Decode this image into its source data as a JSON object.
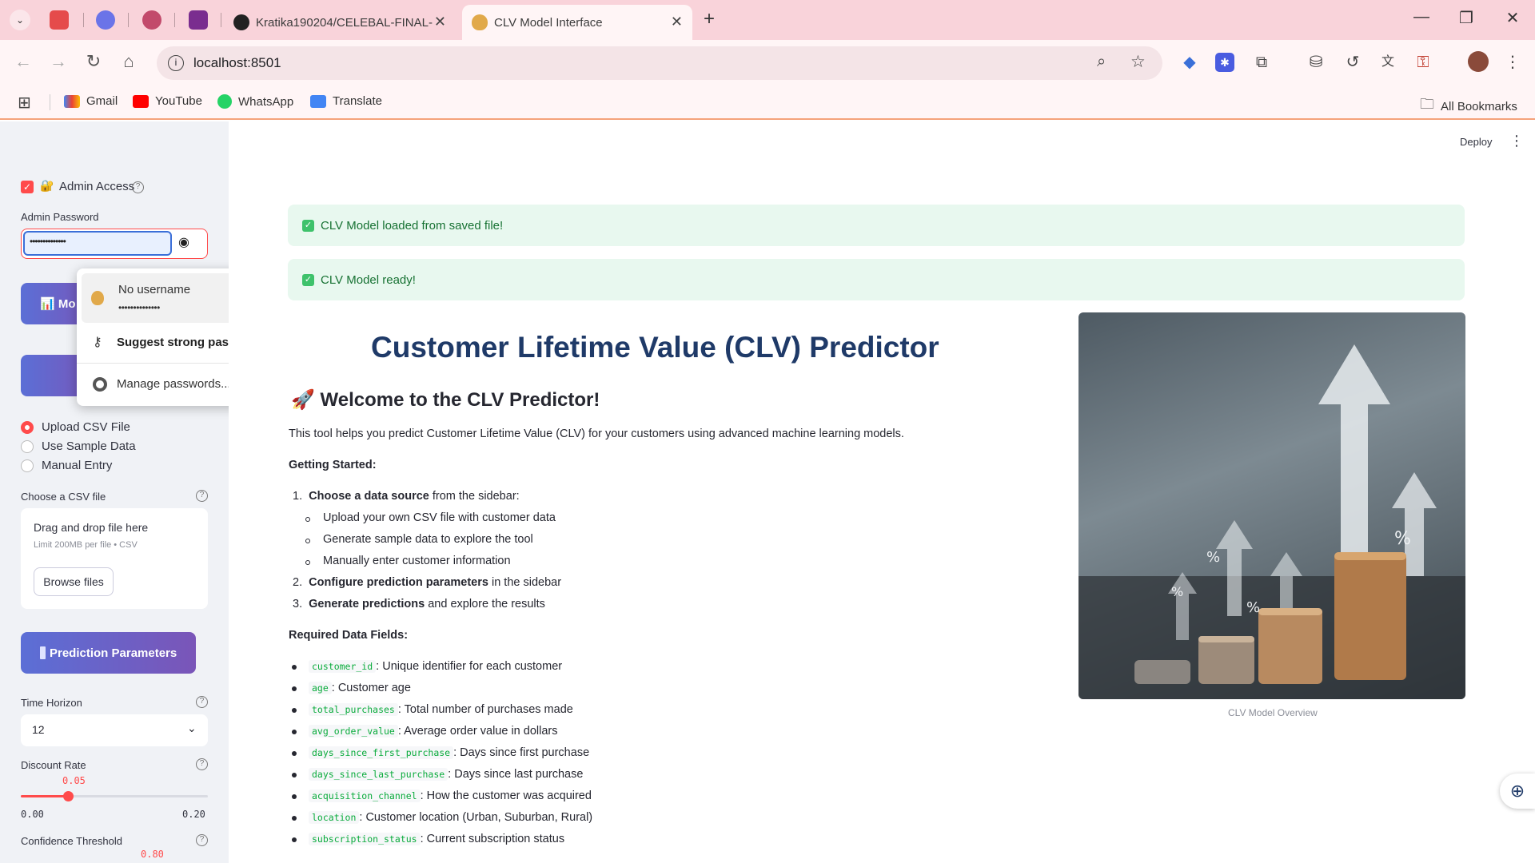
{
  "browser": {
    "tabs": [
      {
        "title": "Kratika190204/CELEBAL-FINAL-",
        "active": false
      },
      {
        "title": "CLV Model Interface",
        "active": true
      }
    ],
    "url": "localhost:8501",
    "bookmarks": [
      "Gmail",
      "YouTube",
      "WhatsApp",
      "Translate"
    ],
    "all_bookmarks": "All Bookmarks"
  },
  "app": {
    "deploy_label": "Deploy",
    "menu_icon": "kebab-menu-icon"
  },
  "sidebar": {
    "admin_access": {
      "label": "Admin Access",
      "emoji": "🔐",
      "checked": true
    },
    "admin_password": {
      "label": "Admin Password",
      "value": "••••••••••••••"
    },
    "model_button_label": "📊 Mo",
    "data_source_options": [
      {
        "label": "Upload CSV File",
        "selected": true
      },
      {
        "label": "Use Sample Data",
        "selected": false
      },
      {
        "label": "Manual Entry",
        "selected": false
      }
    ],
    "uploader": {
      "label": "Choose a CSV file",
      "drag_text": "Drag and drop file here",
      "limit_text": "Limit 200MB per file • CSV",
      "browse_label": "Browse files"
    },
    "prediction_params_label": "Prediction Parameters",
    "time_horizon": {
      "label": "Time Horizon",
      "value": "12"
    },
    "discount_rate": {
      "label": "Discount Rate",
      "value": "0.05",
      "min": "0.00",
      "max": "0.20",
      "fraction": 0.25
    },
    "confidence_threshold": {
      "label": "Confidence Threshold",
      "value": "0.80"
    }
  },
  "password_popup": {
    "saved_user": "No username",
    "saved_pass": "••••••••••••••",
    "suggest": "Suggest strong password...",
    "manage": "Manage passwords..."
  },
  "main": {
    "alerts": [
      "CLV Model loaded from saved file!",
      "CLV Model ready!"
    ],
    "title": "Customer Lifetime Value (CLV) Predictor",
    "welcome": "🚀 Welcome to the CLV Predictor!",
    "intro": "This tool helps you predict Customer Lifetime Value (CLV) for your customers using advanced machine learning models.",
    "getting_started": "Getting Started:",
    "steps": [
      {
        "num": "1.",
        "bold": "Choose a data source",
        "rest": " from the sidebar:"
      },
      {
        "num": "2.",
        "bold": "Configure prediction parameters",
        "rest": " in the sidebar"
      },
      {
        "num": "3.",
        "bold": "Generate predictions",
        "rest": " and explore the results"
      }
    ],
    "substeps": [
      "Upload your own CSV file with customer data",
      "Generate sample data to explore the tool",
      "Manually enter customer information"
    ],
    "required_fields_title": "Required Data Fields:",
    "fields": [
      {
        "code": "customer_id",
        "desc": ": Unique identifier for each customer"
      },
      {
        "code": "age",
        "desc": ": Customer age"
      },
      {
        "code": "total_purchases",
        "desc": ": Total number of purchases made"
      },
      {
        "code": "avg_order_value",
        "desc": ": Average order value in dollars"
      },
      {
        "code": "days_since_first_purchase",
        "desc": ": Days since first purchase"
      },
      {
        "code": "days_since_last_purchase",
        "desc": ": Days since last purchase"
      },
      {
        "code": "acquisition_channel",
        "desc": ": How the customer was acquired"
      },
      {
        "code": "location",
        "desc": ": Customer location (Urban, Suburban, Rural)"
      },
      {
        "code": "subscription_status",
        "desc": ": Current subscription status"
      }
    ],
    "image_caption": "CLV Model Overview"
  }
}
